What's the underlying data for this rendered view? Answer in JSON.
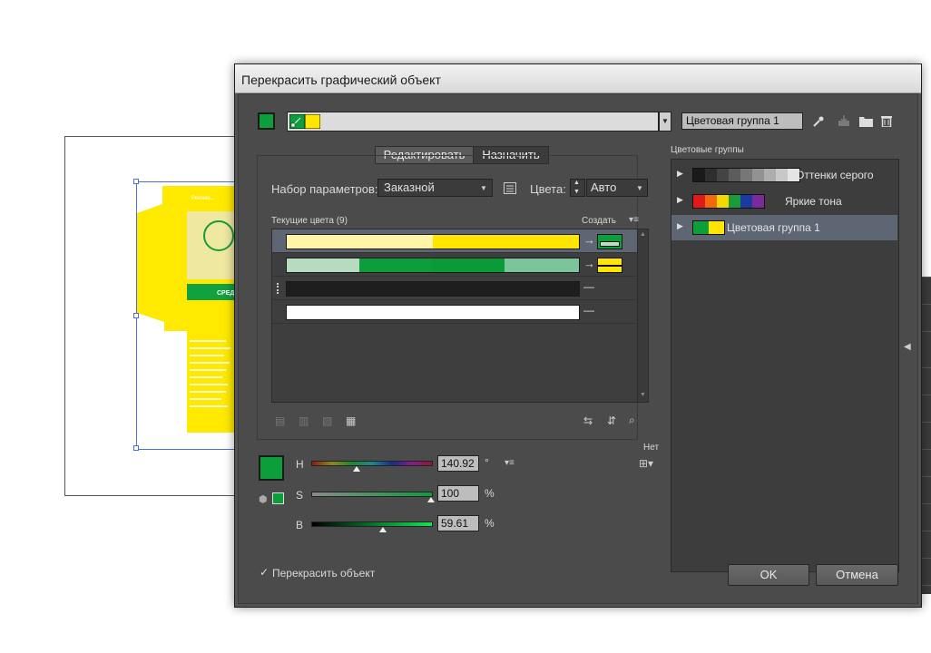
{
  "dialog": {
    "title": "Перекрасить графический объект",
    "group_name_value": "Цветовая группа 1",
    "tabs": {
      "edit": "Редактировать",
      "assign": "Назначить"
    },
    "preset_label": "Набор параметров:",
    "preset_value": "Заказной",
    "colors_label": "Цвета:",
    "colors_value": "Авто",
    "current_colors_label": "Текущие цвета (9)",
    "create_label": "Создать",
    "none_label": "Нет",
    "hsb": {
      "h_label": "H",
      "h_value": "140.92",
      "h_unit": "°",
      "s_label": "S",
      "s_value": "100",
      "s_unit": "%",
      "b_label": "B",
      "b_value": "59.61",
      "b_unit": "%"
    },
    "recolor_checkbox_label": "Перекрасить объект",
    "recolor_checked": true,
    "ok_label": "OK",
    "cancel_label": "Отмена",
    "color_groups_label": "Цветовые группы",
    "color_groups": [
      {
        "name": "Оттенки серого"
      },
      {
        "name": "Яркие тона"
      },
      {
        "name": "Цветовая группа 1"
      }
    ]
  },
  "artwork": {
    "texts": [
      "Рекоме...",
      "СРЕД"
    ]
  },
  "colors": {
    "accent_green": "#0b9e3a",
    "yellow": "#ffe500",
    "dialog_bg": "#4b4b4b",
    "selection": "#5e6673"
  },
  "icons": {
    "eyedropper": "eyedropper-icon",
    "save_group": "save-group-icon",
    "new_folder": "folder-icon",
    "trash": "trash-icon"
  }
}
